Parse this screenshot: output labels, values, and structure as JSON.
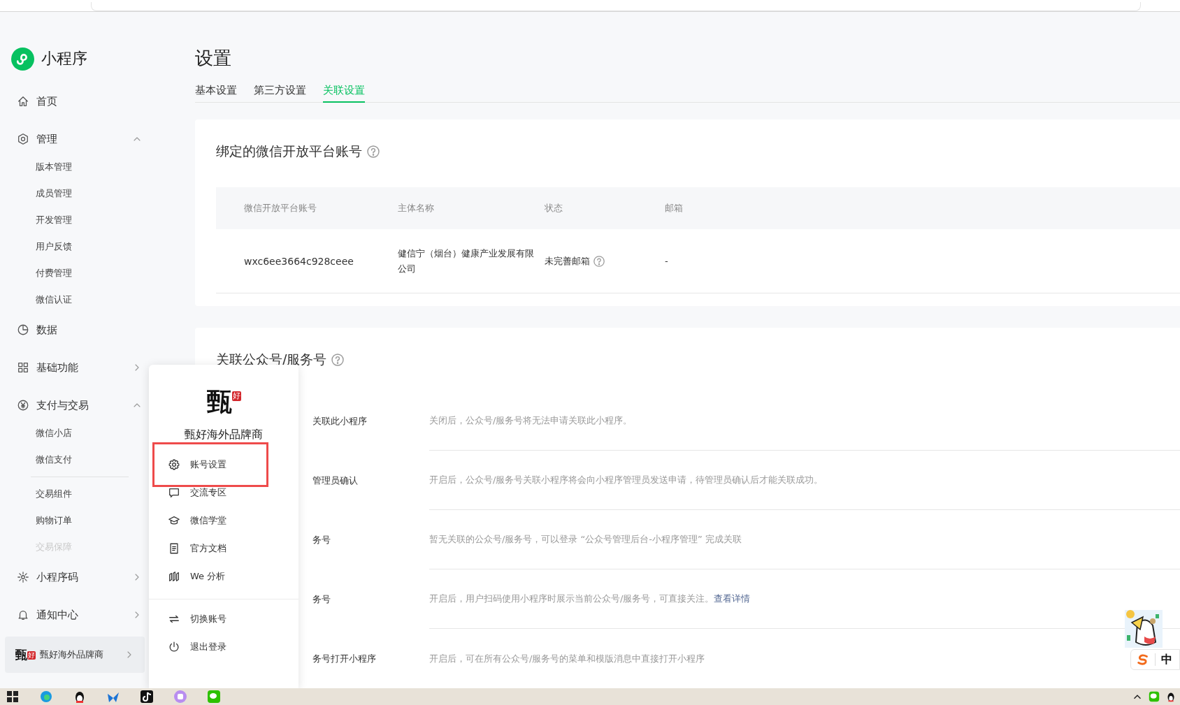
{
  "sidebar": {
    "logo_text": "小程序",
    "items": [
      {
        "kind": "link",
        "label": "首页"
      },
      {
        "kind": "group",
        "label": "管理",
        "expanded": true,
        "children": [
          {
            "kind": "link",
            "label": "版本管理",
            "disabled": false
          },
          {
            "kind": "link",
            "label": "成员管理",
            "disabled": false
          },
          {
            "kind": "link",
            "label": "开发管理",
            "disabled": false
          },
          {
            "kind": "link",
            "label": "用户反馈",
            "disabled": false
          },
          {
            "kind": "link",
            "label": "付费管理",
            "disabled": false
          },
          {
            "kind": "link",
            "label": "微信认证",
            "disabled": false
          }
        ]
      },
      {
        "kind": "link",
        "label": "数据"
      },
      {
        "kind": "group",
        "label": "基础功能",
        "expanded": false
      },
      {
        "kind": "group",
        "label": "支付与交易",
        "expanded": true,
        "children": [
          {
            "kind": "link",
            "label": "微信小店",
            "disabled": false
          },
          {
            "kind": "link",
            "label": "微信支付",
            "disabled": false
          },
          {
            "kind": "divider"
          },
          {
            "kind": "link",
            "label": "交易组件",
            "disabled": false
          },
          {
            "kind": "link",
            "label": "购物订单",
            "disabled": false
          },
          {
            "kind": "link",
            "label": "交易保障",
            "disabled": true
          }
        ]
      },
      {
        "kind": "group",
        "label": "小程序码",
        "expanded": false
      },
      {
        "kind": "group",
        "label": "通知中心",
        "expanded": false
      }
    ],
    "account": {
      "logo_main": "甄",
      "logo_seal": "好",
      "name": "甄好海外品牌商",
      "active": true
    }
  },
  "page": {
    "title": "设置",
    "tabs": [
      {
        "label": "基本设置",
        "selected": false
      },
      {
        "label": "第三方设置",
        "selected": false
      },
      {
        "label": "关联设置",
        "selected": true
      }
    ],
    "bound_account": {
      "title": "绑定的微信开放平台账号",
      "help": true,
      "columns": [
        "微信开放平台账号",
        "主体名称",
        "状态",
        "邮箱"
      ],
      "rows": [
        {
          "cells": [
            {
              "text": "wxc6ee3664c928ceee",
              "help": false
            },
            {
              "text": "健信宁（烟台）健康产业发展有限公司",
              "help": false
            },
            {
              "text": "未完善邮箱",
              "help": true
            },
            {
              "text": "-",
              "help": false
            }
          ]
        }
      ]
    },
    "linked_accounts": {
      "title": "关联公众号/服务号",
      "help": true,
      "rows": [
        {
          "label": "关联此小程序",
          "description": "关闭后，公众号/服务号将无法申请关联此小程序。"
        },
        {
          "label": "管理员确认",
          "description": "开启后，公众号/服务号关联小程序将会向小程序管理员发送申请，待管理员确认后才能关联成功。"
        },
        {
          "label": "务号",
          "description": "暂无关联的公众号/服务号，可以登录 “公众号管理后台-小程序管理” 完成关联"
        },
        {
          "label": "务号",
          "description": "开启后，用户扫码使用小程序时展示当前公众号/服务号，可直接关注。",
          "link": "查看详情"
        },
        {
          "label": "务号打开小程序",
          "description": "开启后，可在所有公众号/服务号的菜单和模版消息中直接打开小程序"
        }
      ]
    }
  },
  "account_menu": {
    "logo_main": "甄",
    "logo_seal": "好",
    "name": "甄好海外品牌商",
    "groups": [
      [
        {
          "label": "账号设置",
          "selected": true
        },
        {
          "label": "交流专区",
          "selected": false
        },
        {
          "label": "微信学堂",
          "selected": false
        },
        {
          "label": "官方文档",
          "selected": false
        },
        {
          "label": "We 分析",
          "selected": false
        }
      ],
      [
        {
          "label": "切换账号",
          "selected": false
        },
        {
          "label": "退出登录",
          "selected": false
        }
      ]
    ]
  },
  "ime": {
    "label": "中"
  }
}
